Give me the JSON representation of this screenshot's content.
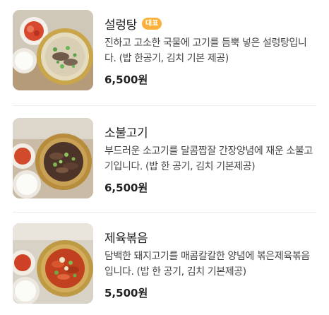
{
  "menu": {
    "items": [
      {
        "name": "설렁탕",
        "badge": "대표",
        "description": "진하고 고소한 국물에 고기를 듬뿍 넣은 설렁탕입니다. (밥 한공기, 김치 기본 제공)",
        "price": "6,500원",
        "image_icon": "seolleongtang-photo"
      },
      {
        "name": "소불고기",
        "badge": "",
        "description": "부드러운 소고기를 달콤짭잘 간장양념에 재운 소불고기입니다. (밥 한 공기, 김치 기본제공)",
        "price": "6,500원",
        "image_icon": "bulgogi-photo"
      },
      {
        "name": "제육볶음",
        "badge": "",
        "description": "담백한 돼지고기를 매콤칼칼한 양념에 볶은제육볶음입니다. (밥 한 공기, 김치 기본제공)",
        "price": "5,500원",
        "image_icon": "jeyuk-photo"
      }
    ]
  },
  "colors": {
    "badge": "#fbb03b",
    "text": "#222222",
    "description": "#444444",
    "divider": "#eeeeee"
  }
}
